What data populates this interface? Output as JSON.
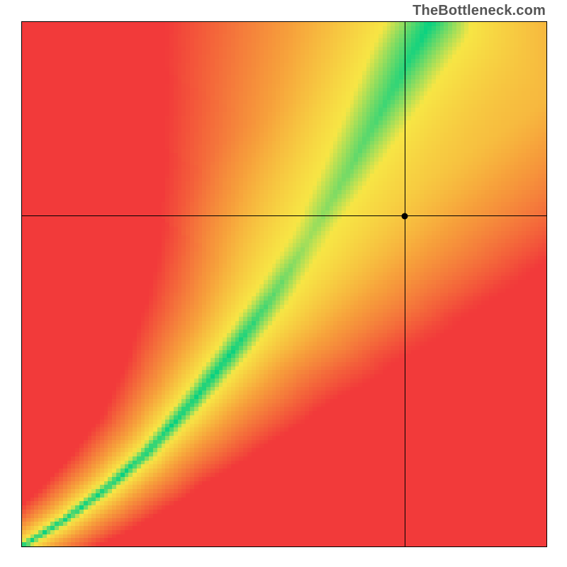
{
  "watermark": "TheBottleneck.com",
  "chart_data": {
    "type": "heatmap",
    "title": "",
    "xlabel": "",
    "ylabel": "",
    "xlim": [
      0,
      1
    ],
    "ylim": [
      0,
      1
    ],
    "grid": false,
    "legend": false,
    "marker": {
      "x": 0.73,
      "y": 0.63
    },
    "ridge": {
      "description": "Green optimal band curve from bottom-left to top-right; surrounded by yellow→orange→red gradient.",
      "points_xy": [
        [
          0.0,
          0.0
        ],
        [
          0.08,
          0.05
        ],
        [
          0.16,
          0.11
        ],
        [
          0.24,
          0.18
        ],
        [
          0.32,
          0.27
        ],
        [
          0.4,
          0.37
        ],
        [
          0.48,
          0.48
        ],
        [
          0.55,
          0.59
        ],
        [
          0.62,
          0.71
        ],
        [
          0.68,
          0.82
        ],
        [
          0.74,
          0.93
        ],
        [
          0.78,
          1.0
        ]
      ],
      "width_profile": [
        [
          0.0,
          0.01
        ],
        [
          0.2,
          0.02
        ],
        [
          0.4,
          0.035
        ],
        [
          0.6,
          0.055
        ],
        [
          0.8,
          0.075
        ],
        [
          1.0,
          0.095
        ]
      ]
    },
    "secondary_ridge": {
      "description": "Faint yellow band diverging to the right near the top.",
      "points_xy": [
        [
          0.55,
          0.58
        ],
        [
          0.7,
          0.66
        ],
        [
          0.85,
          0.75
        ],
        [
          1.0,
          0.85
        ]
      ],
      "width": 0.05,
      "strength": 0.45
    },
    "color_stops": {
      "green": "#00d184",
      "yellow": "#f7e645",
      "orange": "#f7a23c",
      "red": "#f23a3a"
    },
    "pixelation": 128
  }
}
